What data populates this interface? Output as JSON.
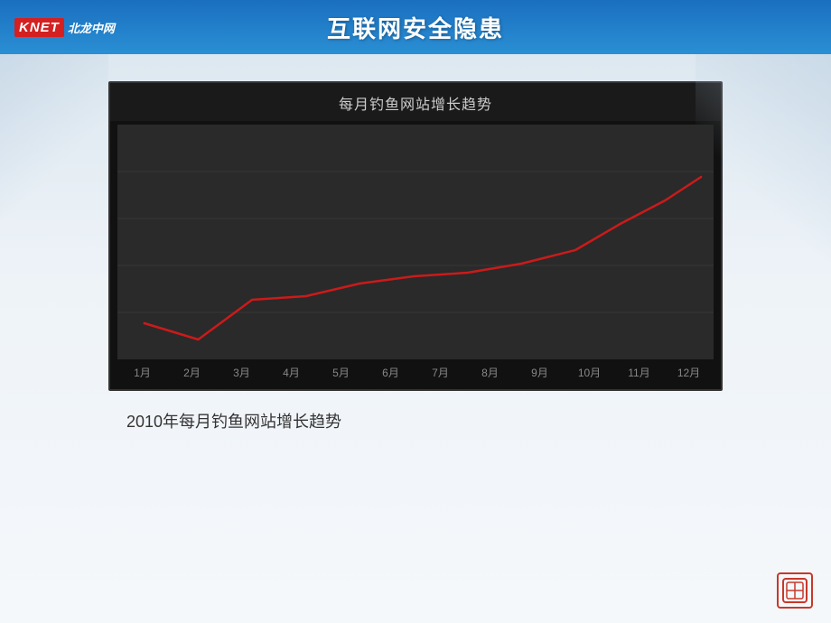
{
  "header": {
    "logo_knet": "KNET",
    "logo_name": "北龙中网",
    "title": "互联网安全隐患"
  },
  "chart": {
    "title": "每月钓鱼网站增长趋势",
    "x_labels": [
      "1月",
      "2月",
      "3月",
      "4月",
      "5月",
      "6月",
      "7月",
      "8月",
      "9月",
      "10月",
      "11月",
      "12月"
    ],
    "data_points": [
      18,
      10,
      30,
      32,
      38,
      42,
      44,
      48,
      55,
      68,
      78,
      92
    ],
    "line_color": "#cc1a1a"
  },
  "caption": "2010年每月钓鱼网站增长趋势",
  "brand_icon": "⊕"
}
